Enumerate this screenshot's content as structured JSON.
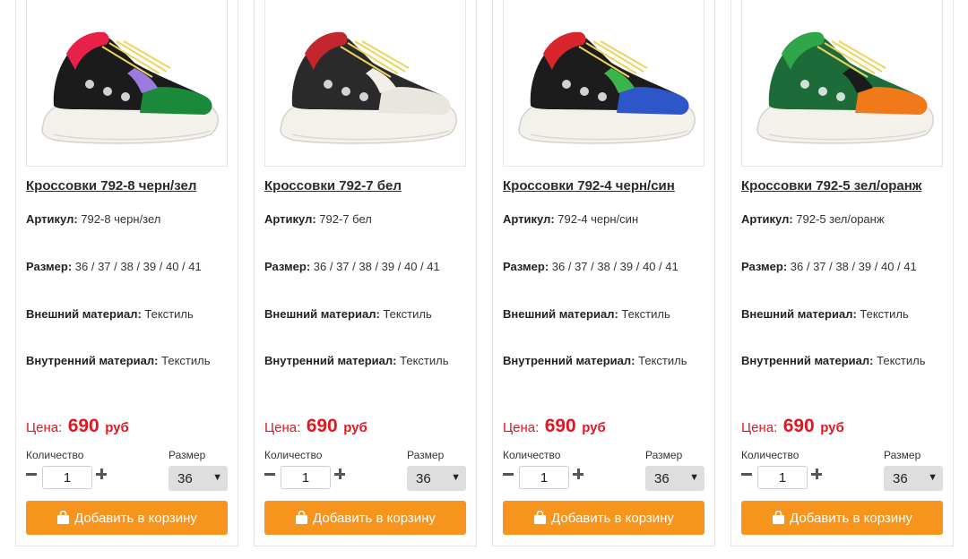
{
  "labels": {
    "article": "Артикул:",
    "size": "Размер:",
    "outer": "Внешний материал:",
    "inner": "Внутренний материал:",
    "price_label": "Цена:",
    "currency": "руб",
    "quantity": "Количество",
    "size_select": "Размер",
    "add_to_cart": "Добавить в корзину"
  },
  "colors": {
    "accent": "#f7941d",
    "price": "#e4151f",
    "select_bg": "#dedede"
  },
  "products": [
    {
      "title": "Кроссовки 792-8 черн/зел",
      "article": "792-8 черн/зел",
      "sizes": "36 / 37 / 38 / 39 / 40 / 41",
      "outer": "Текстиль",
      "inner": "Текстиль",
      "price": "690",
      "quantity": "1",
      "selected_size": "36",
      "image_icon": "sneaker-image",
      "shoe_colors": {
        "toe": "#1a8a3a",
        "upper": "#1b1b1b",
        "accent": "#e8204a",
        "side": "#9c7be0"
      }
    },
    {
      "title": "Кроссовки 792-7 бел",
      "article": "792-7 бел",
      "sizes": "36 / 37 / 38 / 39 / 40 / 41",
      "outer": "Текстиль",
      "inner": "Текстиль",
      "price": "690",
      "quantity": "1",
      "selected_size": "36",
      "image_icon": "sneaker-image",
      "shoe_colors": {
        "toe": "#e9e6e0",
        "upper": "#2a2a2a",
        "accent": "#c3262e",
        "side": "#f2efe9"
      }
    },
    {
      "title": "Кроссовки 792-4 черн/син",
      "article": "792-4 черн/син",
      "sizes": "36 / 37 / 38 / 39 / 40 / 41",
      "outer": "Текстиль",
      "inner": "Текстиль",
      "price": "690",
      "quantity": "1",
      "selected_size": "36",
      "image_icon": "sneaker-image",
      "shoe_colors": {
        "toe": "#2d56c9",
        "upper": "#1c1c1c",
        "accent": "#d8262c",
        "side": "#3bb54a"
      }
    },
    {
      "title": "Кроссовки 792-5 зел/оранж",
      "article": "792-5 зел/оранж",
      "sizes": "36 / 37 / 38 / 39 / 40 / 41",
      "outer": "Текстиль",
      "inner": "Текстиль",
      "price": "690",
      "quantity": "1",
      "selected_size": "36",
      "image_icon": "sneaker-image",
      "shoe_colors": {
        "toe": "#f07a1a",
        "upper": "#1e6b3a",
        "accent": "#2fa64a",
        "side": "#1b1b1b"
      }
    }
  ]
}
